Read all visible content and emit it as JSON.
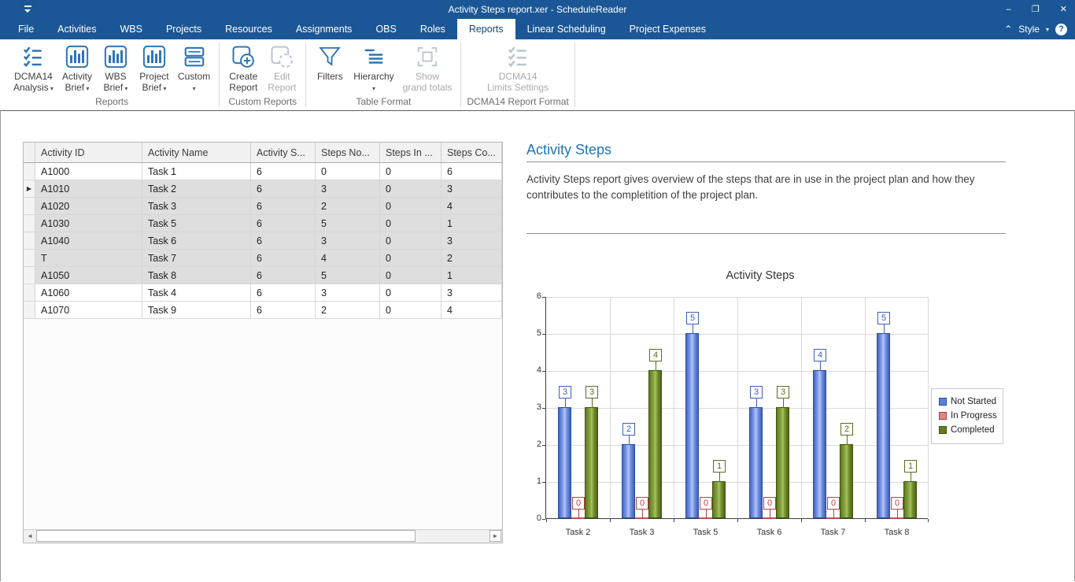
{
  "window": {
    "title": "Activity Steps report.xer - ScheduleReader",
    "controls": [
      {
        "name": "minimize",
        "glyph": "–"
      },
      {
        "name": "restore",
        "glyph": "❐"
      },
      {
        "name": "close",
        "glyph": "✕"
      }
    ]
  },
  "menu": {
    "tabs": [
      {
        "label": "File",
        "active": false
      },
      {
        "label": "Activities",
        "active": false
      },
      {
        "label": "WBS",
        "active": false
      },
      {
        "label": "Projects",
        "active": false
      },
      {
        "label": "Resources",
        "active": false
      },
      {
        "label": "Assignments",
        "active": false
      },
      {
        "label": "OBS",
        "active": false
      },
      {
        "label": "Roles",
        "active": false
      },
      {
        "label": "Reports",
        "active": true
      },
      {
        "label": "Linear Scheduling",
        "active": false
      },
      {
        "label": "Project Expenses",
        "active": false
      }
    ],
    "collapse_glyph": "⌃",
    "style_label": "Style",
    "style_caret": "▾",
    "help_glyph": "?"
  },
  "ribbon": {
    "caret_glyph": "▾",
    "groups": [
      {
        "label": "Reports",
        "buttons": [
          {
            "name": "dcma14-analysis",
            "lines": [
              "DCMA14",
              "Analysis"
            ],
            "caret": true,
            "icon": "checklist-icon",
            "enabled": true
          },
          {
            "name": "activity-brief",
            "lines": [
              "Activity",
              "Brief"
            ],
            "caret": true,
            "icon": "bar-chart-icon",
            "enabled": true
          },
          {
            "name": "wbs-brief",
            "lines": [
              "WBS",
              "Brief"
            ],
            "caret": true,
            "icon": "bar-chart-icon",
            "enabled": true
          },
          {
            "name": "project-brief",
            "lines": [
              "Project",
              "Brief"
            ],
            "caret": true,
            "icon": "bar-chart-icon",
            "enabled": true
          },
          {
            "name": "custom",
            "lines": [
              "Custom"
            ],
            "caret": "below",
            "icon": "custom-report-icon",
            "enabled": true
          }
        ]
      },
      {
        "label": "Custom Reports",
        "buttons": [
          {
            "name": "create-report",
            "lines": [
              "Create",
              "Report"
            ],
            "caret": false,
            "icon": "create-report-icon",
            "enabled": true
          },
          {
            "name": "edit-report",
            "lines": [
              "Edit",
              "Report"
            ],
            "caret": false,
            "icon": "edit-report-icon",
            "enabled": false
          }
        ]
      },
      {
        "label": "Table Format",
        "buttons": [
          {
            "name": "filters",
            "lines": [
              "Filters"
            ],
            "caret": false,
            "icon": "filter-icon",
            "enabled": true
          },
          {
            "name": "hierarchy",
            "lines": [
              "Hierarchy"
            ],
            "caret": "below",
            "icon": "hierarchy-icon",
            "enabled": true
          },
          {
            "name": "show-grand-totals",
            "lines": [
              "Show",
              "grand totals"
            ],
            "caret": false,
            "icon": "grand-totals-icon",
            "enabled": false
          }
        ]
      },
      {
        "label": "DCMA14 Report Format",
        "buttons": [
          {
            "name": "dcma14-limits-settings",
            "lines": [
              "DCMA14",
              "Limits Settings"
            ],
            "caret": false,
            "icon": "checklist-gray-icon",
            "enabled": false
          }
        ]
      }
    ]
  },
  "table": {
    "marker_glyph": "▶",
    "scrollbar": {
      "left_arrow": "◄",
      "right_arrow": "►"
    },
    "columns": [
      "Activity ID",
      "Activity Name",
      "Activity S...",
      "Steps No...",
      "Steps In ...",
      "Steps Co..."
    ],
    "rows": [
      {
        "cells": [
          "A1000",
          "Task 1",
          "6",
          "0",
          "0",
          "6"
        ],
        "selected": false,
        "marker": false
      },
      {
        "cells": [
          "A1010",
          "Task 2",
          "6",
          "3",
          "0",
          "3"
        ],
        "selected": true,
        "marker": true
      },
      {
        "cells": [
          "A1020",
          "Task 3",
          "6",
          "2",
          "0",
          "4"
        ],
        "selected": true,
        "marker": false
      },
      {
        "cells": [
          "A1030",
          "Task 5",
          "6",
          "5",
          "0",
          "1"
        ],
        "selected": true,
        "marker": false
      },
      {
        "cells": [
          "A1040",
          "Task 6",
          "6",
          "3",
          "0",
          "3"
        ],
        "selected": true,
        "marker": false
      },
      {
        "cells": [
          "T",
          "Task 7",
          "6",
          "4",
          "0",
          "2"
        ],
        "selected": true,
        "marker": false
      },
      {
        "cells": [
          "A1050",
          "Task 8",
          "6",
          "5",
          "0",
          "1"
        ],
        "selected": true,
        "marker": false
      },
      {
        "cells": [
          "A1060",
          "Task 4",
          "6",
          "3",
          "0",
          "3"
        ],
        "selected": false,
        "marker": false
      },
      {
        "cells": [
          "A1070",
          "Task 9",
          "6",
          "2",
          "0",
          "4"
        ],
        "selected": false,
        "marker": false
      }
    ]
  },
  "report": {
    "title": "Activity Steps",
    "description": "Activity Steps report gives overview of the steps that are in use in the project plan and how they contributes to the completition of the project plan."
  },
  "chart_data": {
    "type": "bar",
    "title": "Activity Steps",
    "categories": [
      "Task 2",
      "Task 3",
      "Task 5",
      "Task 6",
      "Task 7",
      "Task 8"
    ],
    "series": [
      {
        "name": "Not Started",
        "color": "#4472c4",
        "values": [
          3,
          2,
          5,
          3,
          4,
          5
        ]
      },
      {
        "name": "In Progress",
        "color": "#c0504d",
        "values": [
          0,
          0,
          0,
          0,
          0,
          0
        ]
      },
      {
        "name": "Completed",
        "color": "#5f7d1e",
        "values": [
          3,
          4,
          1,
          3,
          2,
          1
        ]
      }
    ],
    "xlabel": "",
    "ylabel": "",
    "ylim": [
      0,
      6
    ],
    "ytick_step": 1,
    "grid": true,
    "data_labels": true,
    "legend_position": "right"
  }
}
